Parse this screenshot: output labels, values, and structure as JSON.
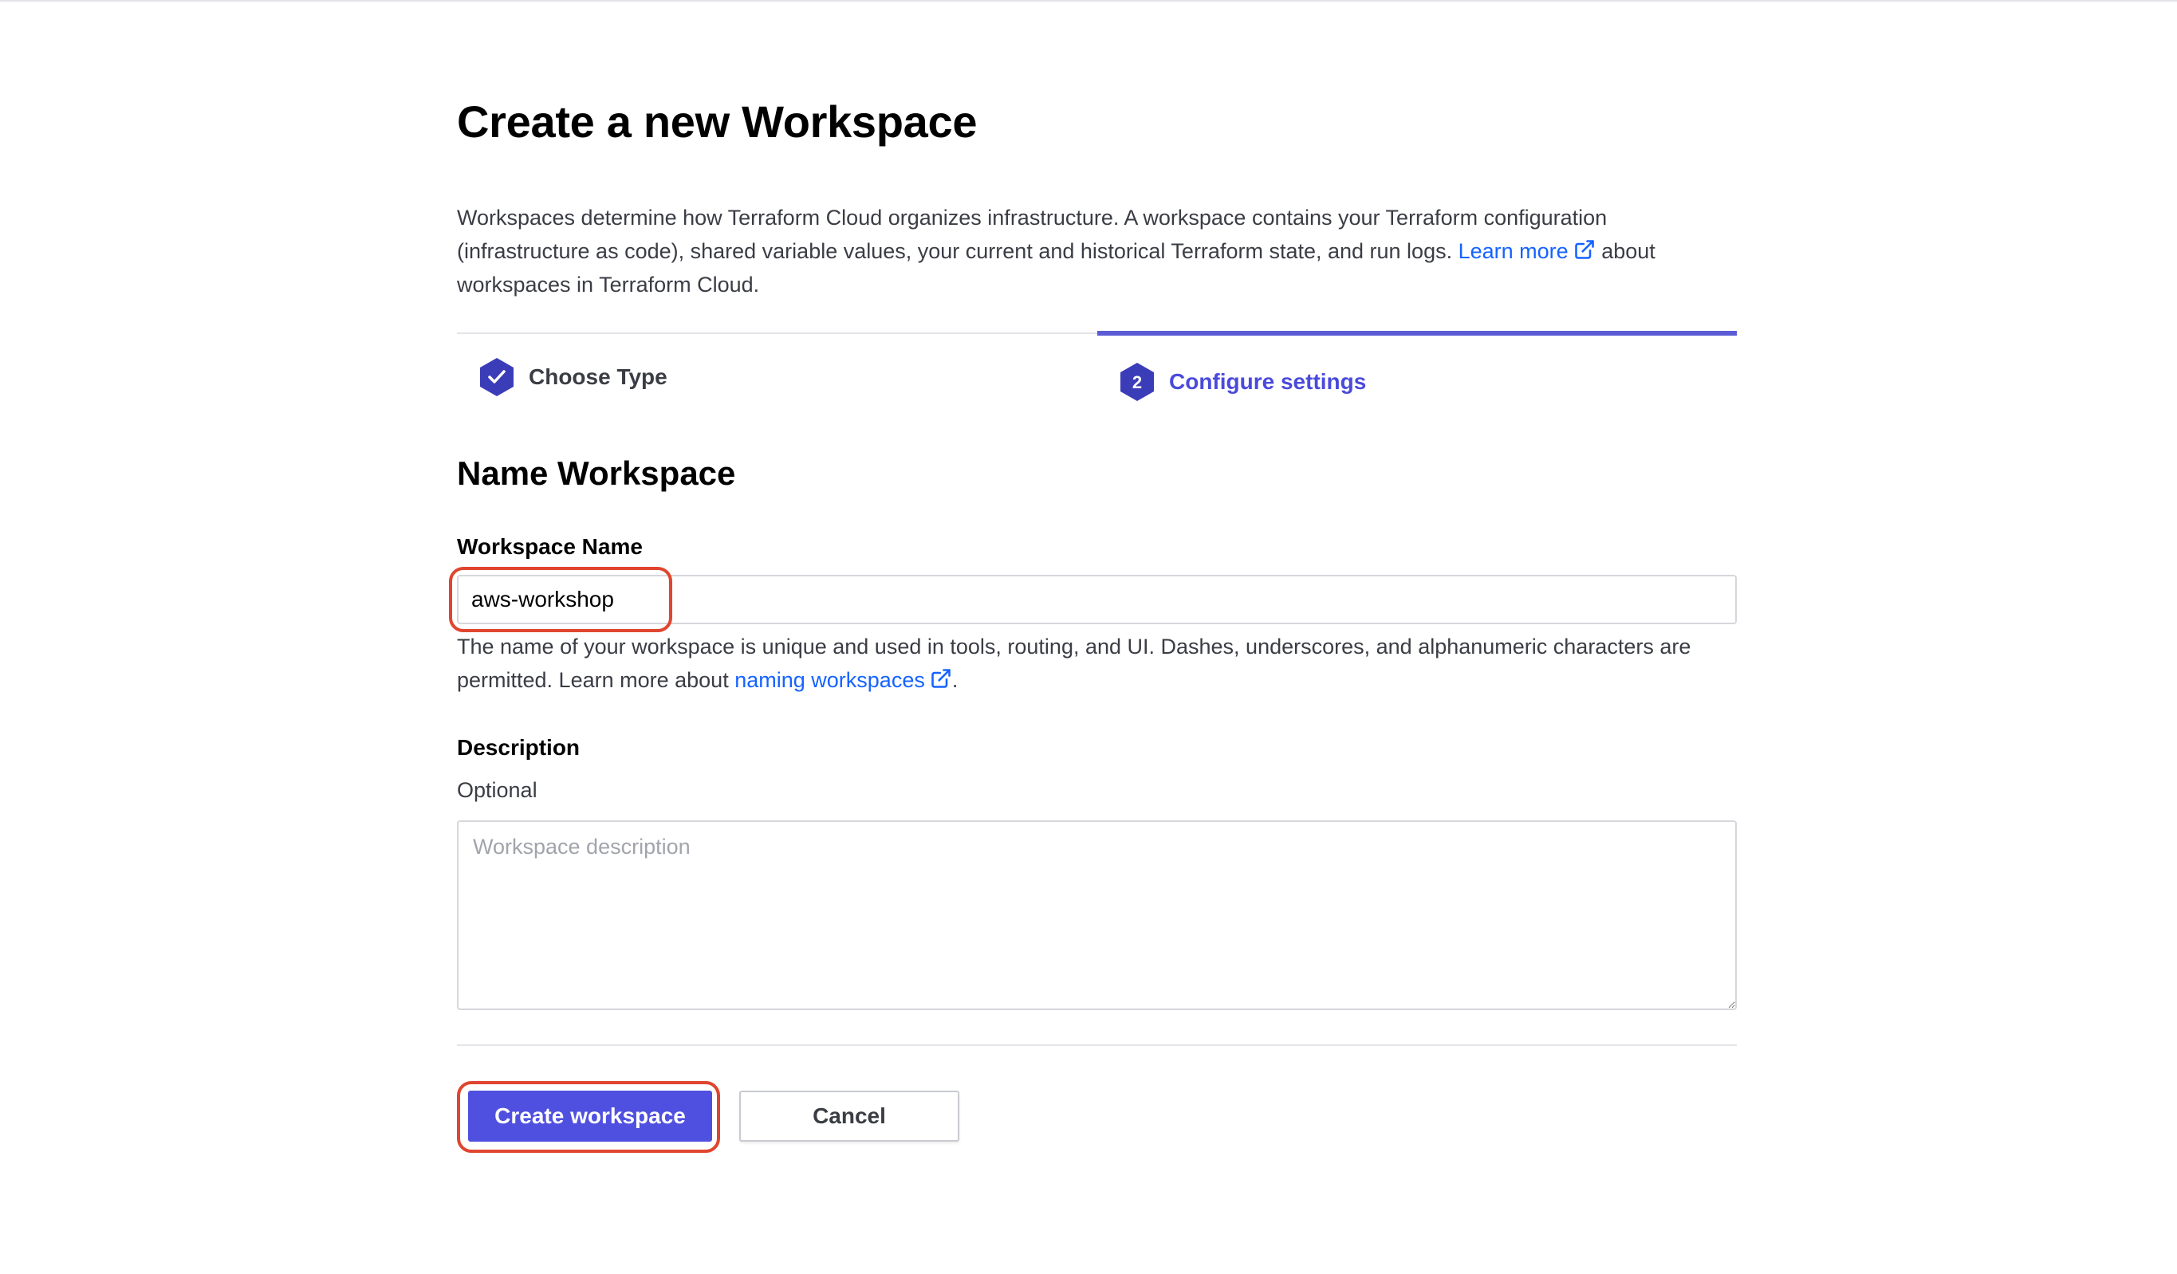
{
  "page": {
    "title": "Create a new Workspace",
    "intro_text": "Workspaces determine how Terraform Cloud organizes infrastructure. A workspace contains your Terraform configuration (infrastructure as code), shared variable values, your current and historical Terraform state, and run logs.",
    "intro_link": "Learn more",
    "intro_suffix": "about workspaces in Terraform Cloud."
  },
  "steps": [
    {
      "label": "Choose Type",
      "state": "complete",
      "icon": "check-icon"
    },
    {
      "label": "Configure settings",
      "state": "active",
      "number": "2"
    }
  ],
  "form": {
    "section_title": "Name Workspace",
    "name_label": "Workspace Name",
    "name_value": "aws-workshop",
    "name_help": "The name of your workspace is unique and used in tools, routing, and UI. Dashes, underscores, and alphanumeric characters are permitted. Learn more about",
    "name_help_link": "naming workspaces",
    "name_help_end": ".",
    "description_label": "Description",
    "description_optional": "Optional",
    "description_placeholder": "Workspace description",
    "description_value": ""
  },
  "actions": {
    "create_label": "Create workspace",
    "cancel_label": "Cancel"
  },
  "colors": {
    "accent": "#5050e0",
    "step_hex": "#3b3db8",
    "link": "#1563ff",
    "highlight": "#e0452f"
  }
}
